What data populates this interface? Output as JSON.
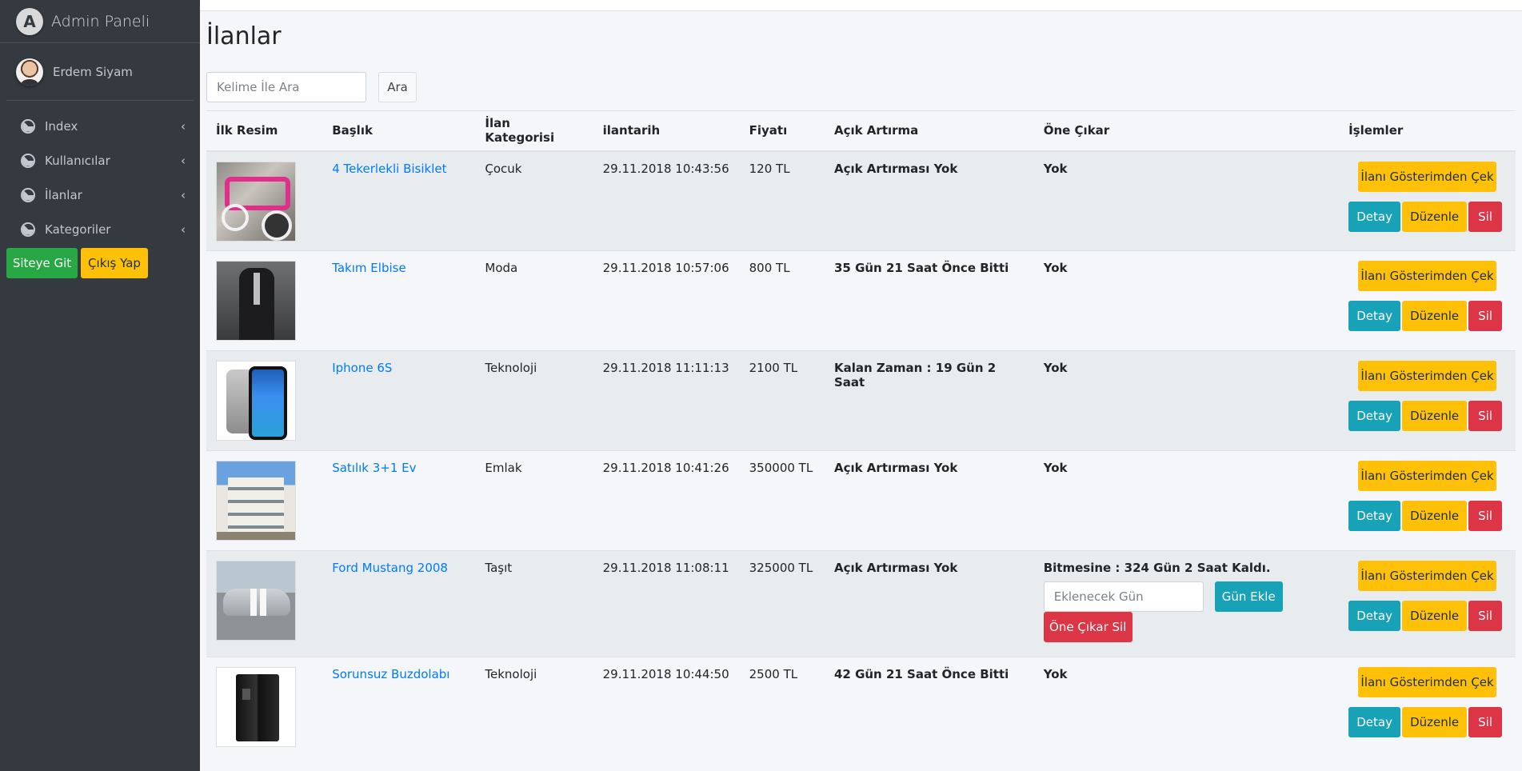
{
  "brand": {
    "logo_letter": "A",
    "title": "Admin Paneli"
  },
  "user": {
    "name": "Erdem Siyam"
  },
  "nav": [
    {
      "label": "Index",
      "chevron": "‹"
    },
    {
      "label": "Kullanıcılar",
      "chevron": "‹"
    },
    {
      "label": "İlanlar",
      "chevron": "‹"
    },
    {
      "label": "Kategoriler",
      "chevron": "‹"
    }
  ],
  "side_buttons": {
    "site": "Siteye Git",
    "logout": "Çıkış Yap"
  },
  "page": {
    "title": "İlanlar"
  },
  "search": {
    "placeholder": "Kelime İle Ara",
    "button": "Ara"
  },
  "table": {
    "headers": [
      "İlk Resim",
      "Başlık",
      "İlan Kategorisi",
      "ilantarih",
      "Fiyatı",
      "Açık Artırma",
      "Öne Çıkar",
      "İşlemler"
    ],
    "rows": [
      {
        "image": "bike-photo",
        "title": "4 Tekerlekli Bisiklet",
        "category": "Çocuk",
        "date": "29.11.2018 10:43:56",
        "price": "120 TL",
        "auction": "Açık Artırması Yok",
        "featured": "Yok"
      },
      {
        "image": "suit-photo",
        "title": "Takım Elbise",
        "category": "Moda",
        "date": "29.11.2018 10:57:06",
        "price": "800 TL",
        "auction": "35 Gün 21 Saat Önce Bitti",
        "featured": "Yok"
      },
      {
        "image": "phone-photo",
        "title": "Iphone 6S",
        "category": "Teknoloji",
        "date": "29.11.2018 11:11:13",
        "price": "2100 TL",
        "auction": "Kalan Zaman : 19 Gün 2 Saat",
        "featured": "Yok"
      },
      {
        "image": "house-photo",
        "title": "Satılık 3+1 Ev",
        "category": "Emlak",
        "date": "29.11.2018 10:41:26",
        "price": "350000 TL",
        "auction": "Açık Artırması Yok",
        "featured": "Yok"
      },
      {
        "image": "car-photo",
        "title": "Ford Mustang 2008",
        "category": "Taşıt",
        "date": "29.11.2018 11:08:11",
        "price": "325000 TL",
        "auction": "Açık Artırması Yok",
        "featured": "Bitmesine : 324 Gün 2 Saat Kaldı."
      },
      {
        "image": "fridge-photo",
        "title": "Sorunsuz Buzdolabı",
        "category": "Teknoloji",
        "date": "29.11.2018 10:44:50",
        "price": "2500 TL",
        "auction": "42 Gün 21 Saat Önce Bitti",
        "featured": "Yok"
      }
    ]
  },
  "featured_controls": {
    "day_placeholder": "Eklenecek Gün",
    "add_day": "Gün Ekle",
    "remove_featured": "Öne Çıkar Sil"
  },
  "actions": {
    "hide": "İlanı Gösterimden Çek",
    "detail": "Detay",
    "edit": "Düzenle",
    "delete": "Sil"
  },
  "colors": {
    "sidebar": "#343a40",
    "link": "#007bff",
    "success": "#28a745",
    "warning": "#ffc107",
    "info": "#17a2b8",
    "danger": "#dc3545"
  }
}
